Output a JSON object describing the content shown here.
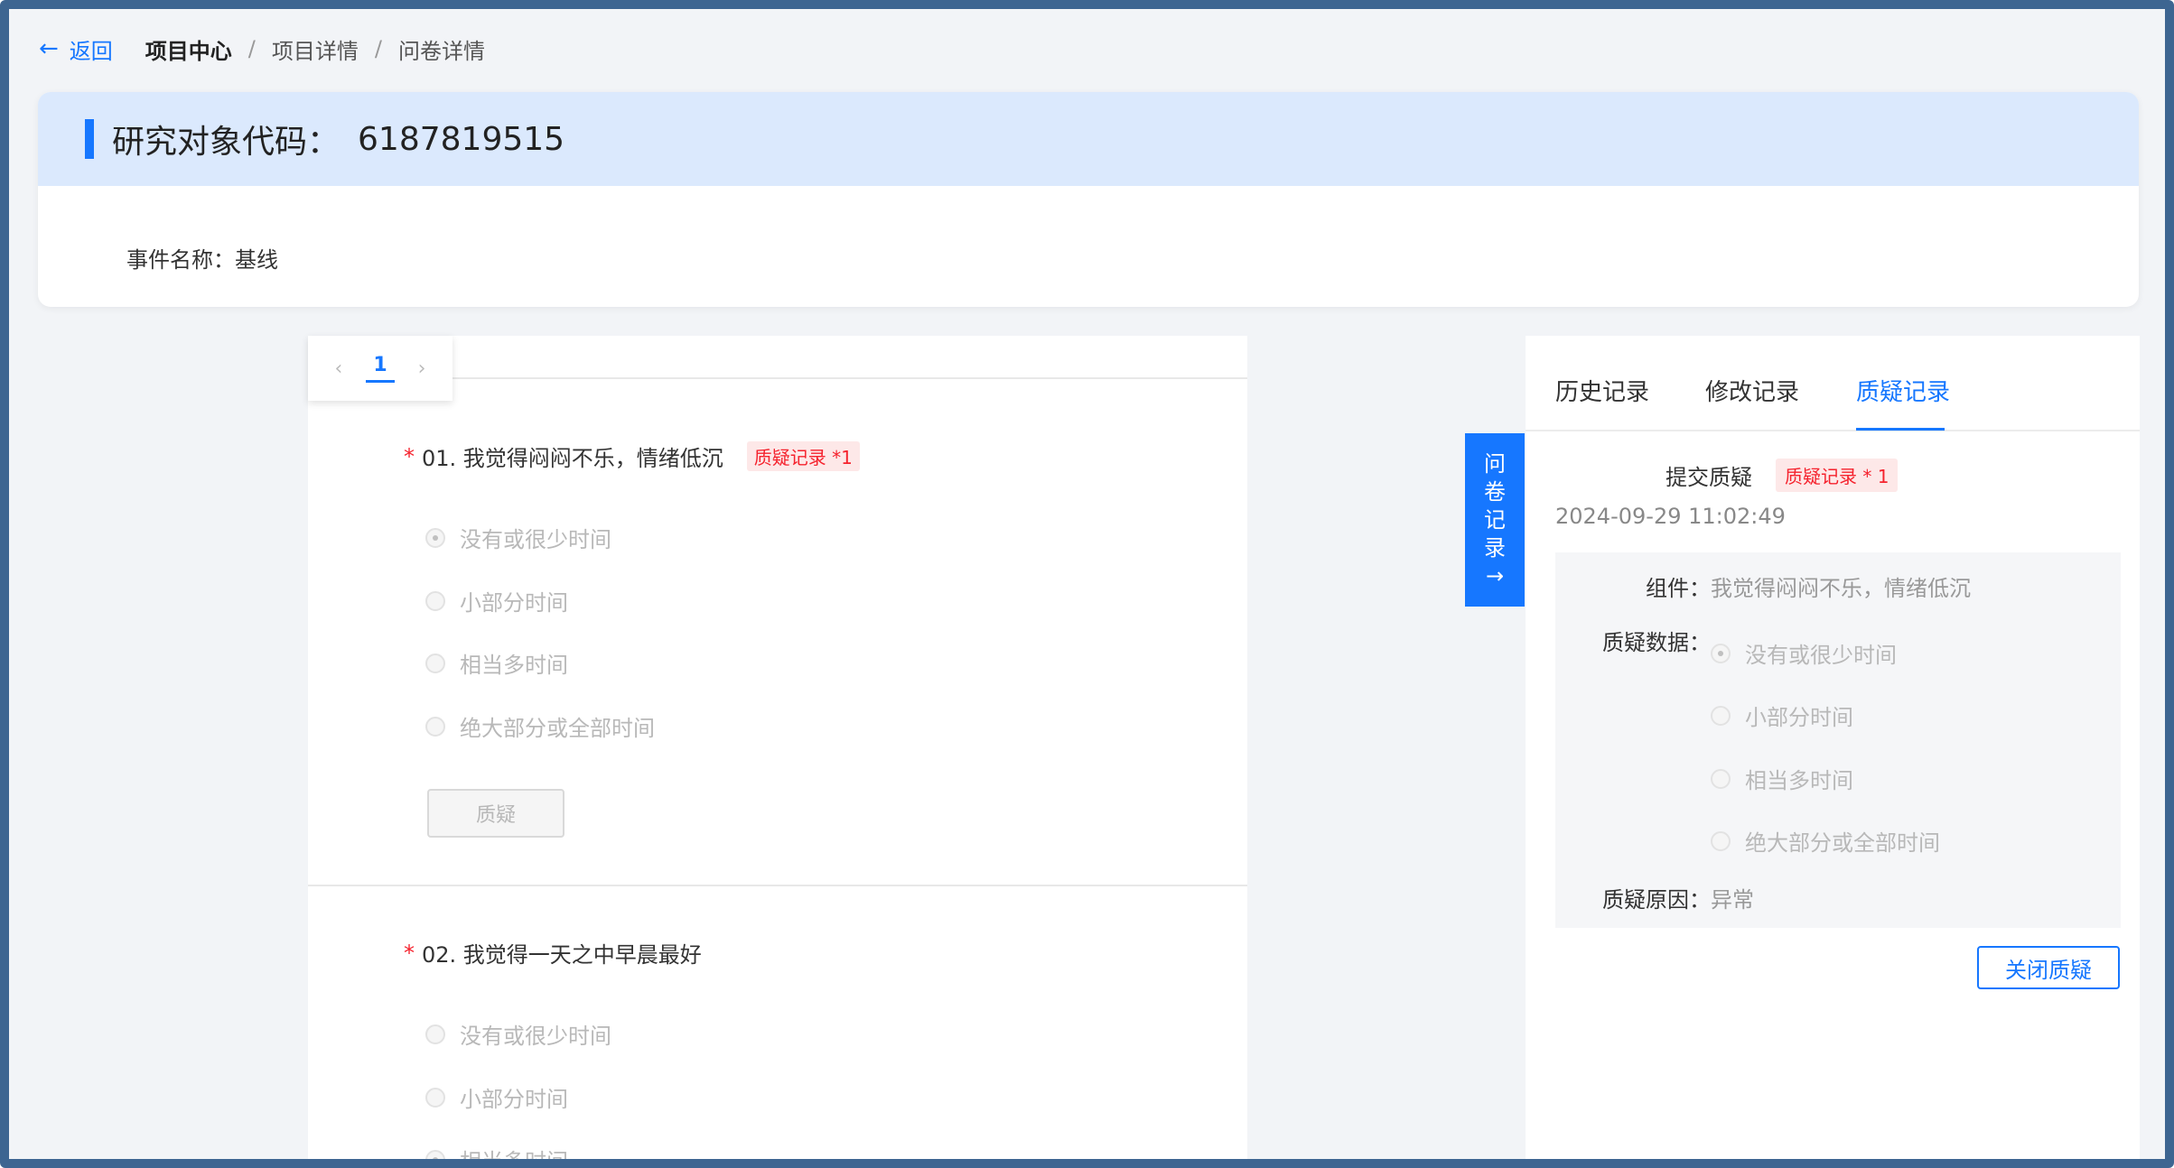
{
  "breadcrumb": {
    "back_label": "返回",
    "items": [
      "项目中心",
      "项目详情",
      "问卷详情"
    ],
    "separator": "/"
  },
  "header": {
    "title_label": "研究对象代码：",
    "subject_code": "6187819515",
    "event_label": "事件名称：",
    "event_value": "基线"
  },
  "pager": {
    "current_page": "1"
  },
  "questions": [
    {
      "required_mark": "*",
      "title": "01. 我觉得闷闷不乐，情绪低沉",
      "query_tag": "质疑记录 *1",
      "options": [
        "没有或很少时间",
        "小部分时间",
        "相当多时间",
        "绝大部分或全部时间"
      ],
      "selected_index": 0,
      "query_button": "质疑"
    },
    {
      "required_mark": "*",
      "title": "02. 我觉得一天之中早晨最好",
      "options": [
        "没有或很少时间",
        "小部分时间",
        "相当多时间"
      ],
      "selected_index": 2
    }
  ],
  "side_tab": {
    "chars": [
      "问",
      "卷",
      "记",
      "录"
    ],
    "arrow": "→"
  },
  "right_panel": {
    "tabs": [
      "历史记录",
      "修改记录",
      "质疑记录"
    ],
    "active_tab": "质疑记录",
    "submit_label": "提交质疑",
    "submit_tag": "质疑记录 * 1",
    "timestamp": "2024-09-29 11:02:49",
    "component_label": "组件：",
    "component_value": "我觉得闷闷不乐，情绪低沉",
    "query_data_label": "质疑数据：",
    "query_options": [
      "没有或很少时间",
      "小部分时间",
      "相当多时间",
      "绝大部分或全部时间"
    ],
    "query_selected_index": 0,
    "reason_label": "质疑原因：",
    "reason_value": "异常",
    "close_button": "关闭质疑"
  },
  "colors": {
    "accent": "#1677ff",
    "frame": "#3d6591",
    "header_band": "#dbe9fd",
    "danger": "#f5222d"
  }
}
